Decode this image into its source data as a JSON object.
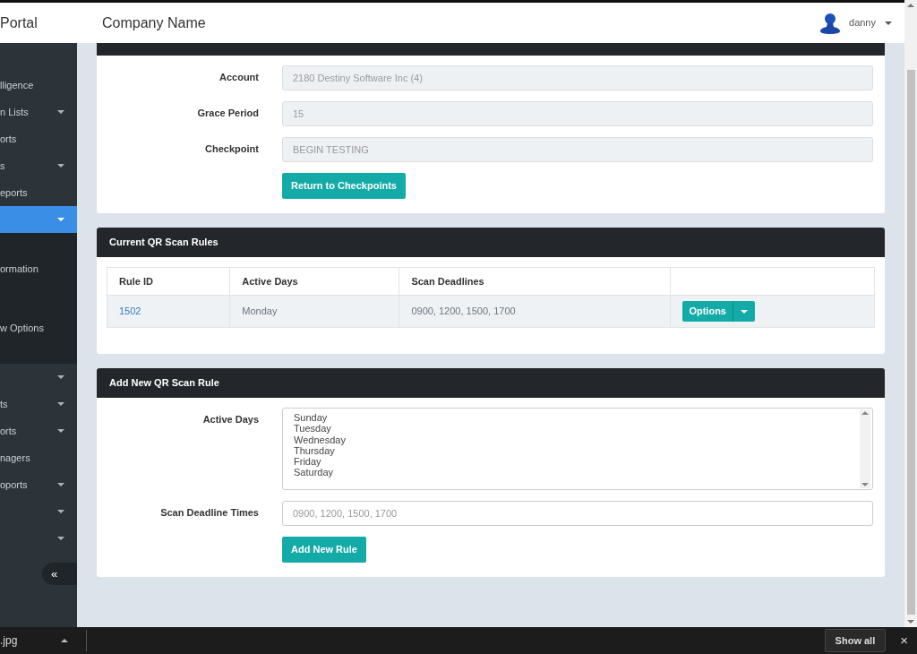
{
  "header": {
    "brand": "Portal",
    "company": "Company Name",
    "user": "danny"
  },
  "sidebar": {
    "items": [
      {
        "text": "lligence",
        "caret": false,
        "selected": false
      },
      {
        "text": "n Lists",
        "caret": true,
        "selected": false
      },
      {
        "text": "orts",
        "caret": false,
        "selected": false
      },
      {
        "text": "s",
        "caret": true,
        "selected": false
      },
      {
        "text": "eports",
        "caret": false,
        "selected": false
      },
      {
        "caret": true,
        "selected": true,
        "children": [
          {
            "text": "ormation"
          },
          {
            "text": "w Options"
          }
        ]
      },
      {
        "caret": true,
        "selected": false
      },
      {
        "text": "ts",
        "caret": true,
        "selected": false
      },
      {
        "text": "orts",
        "caret": true,
        "selected": false
      },
      {
        "text": "nagers",
        "caret": false,
        "selected": false
      },
      {
        "text": "oports",
        "caret": true,
        "selected": false
      },
      {
        "caret": true,
        "selected": false
      },
      {
        "caret": true,
        "selected": false
      }
    ],
    "collapse": "«"
  },
  "details": {
    "fields": [
      {
        "label": "Account",
        "value": "2180 Destiny Software Inc (4)"
      },
      {
        "label": "Grace Period",
        "value": "15"
      },
      {
        "label": "Checkpoint",
        "value": "BEGIN TESTING"
      }
    ],
    "button": "Return to Checkpoints"
  },
  "rules": {
    "title": "Current QR Scan Rules",
    "columns": [
      "Rule ID",
      "Active Days",
      "Scan Deadlines"
    ],
    "rows": [
      {
        "id": "1502",
        "days": "Monday",
        "deadlines": "0900, 1200, 1500, 1700",
        "action": "Options"
      }
    ]
  },
  "new_rule": {
    "title": "Add New QR Scan Rule",
    "days_label": "Active Days",
    "days": [
      "Sunday",
      "Tuesday",
      "Wednesday",
      "Thursday",
      "Friday",
      "Saturday"
    ],
    "times_label": "Scan Deadline Times",
    "times_placeholder": "0900, 1200, 1500, 1700",
    "button": "Add New Rule"
  },
  "download_bar": {
    "file": ".jpg",
    "show_all": "Show all",
    "close": "×"
  }
}
